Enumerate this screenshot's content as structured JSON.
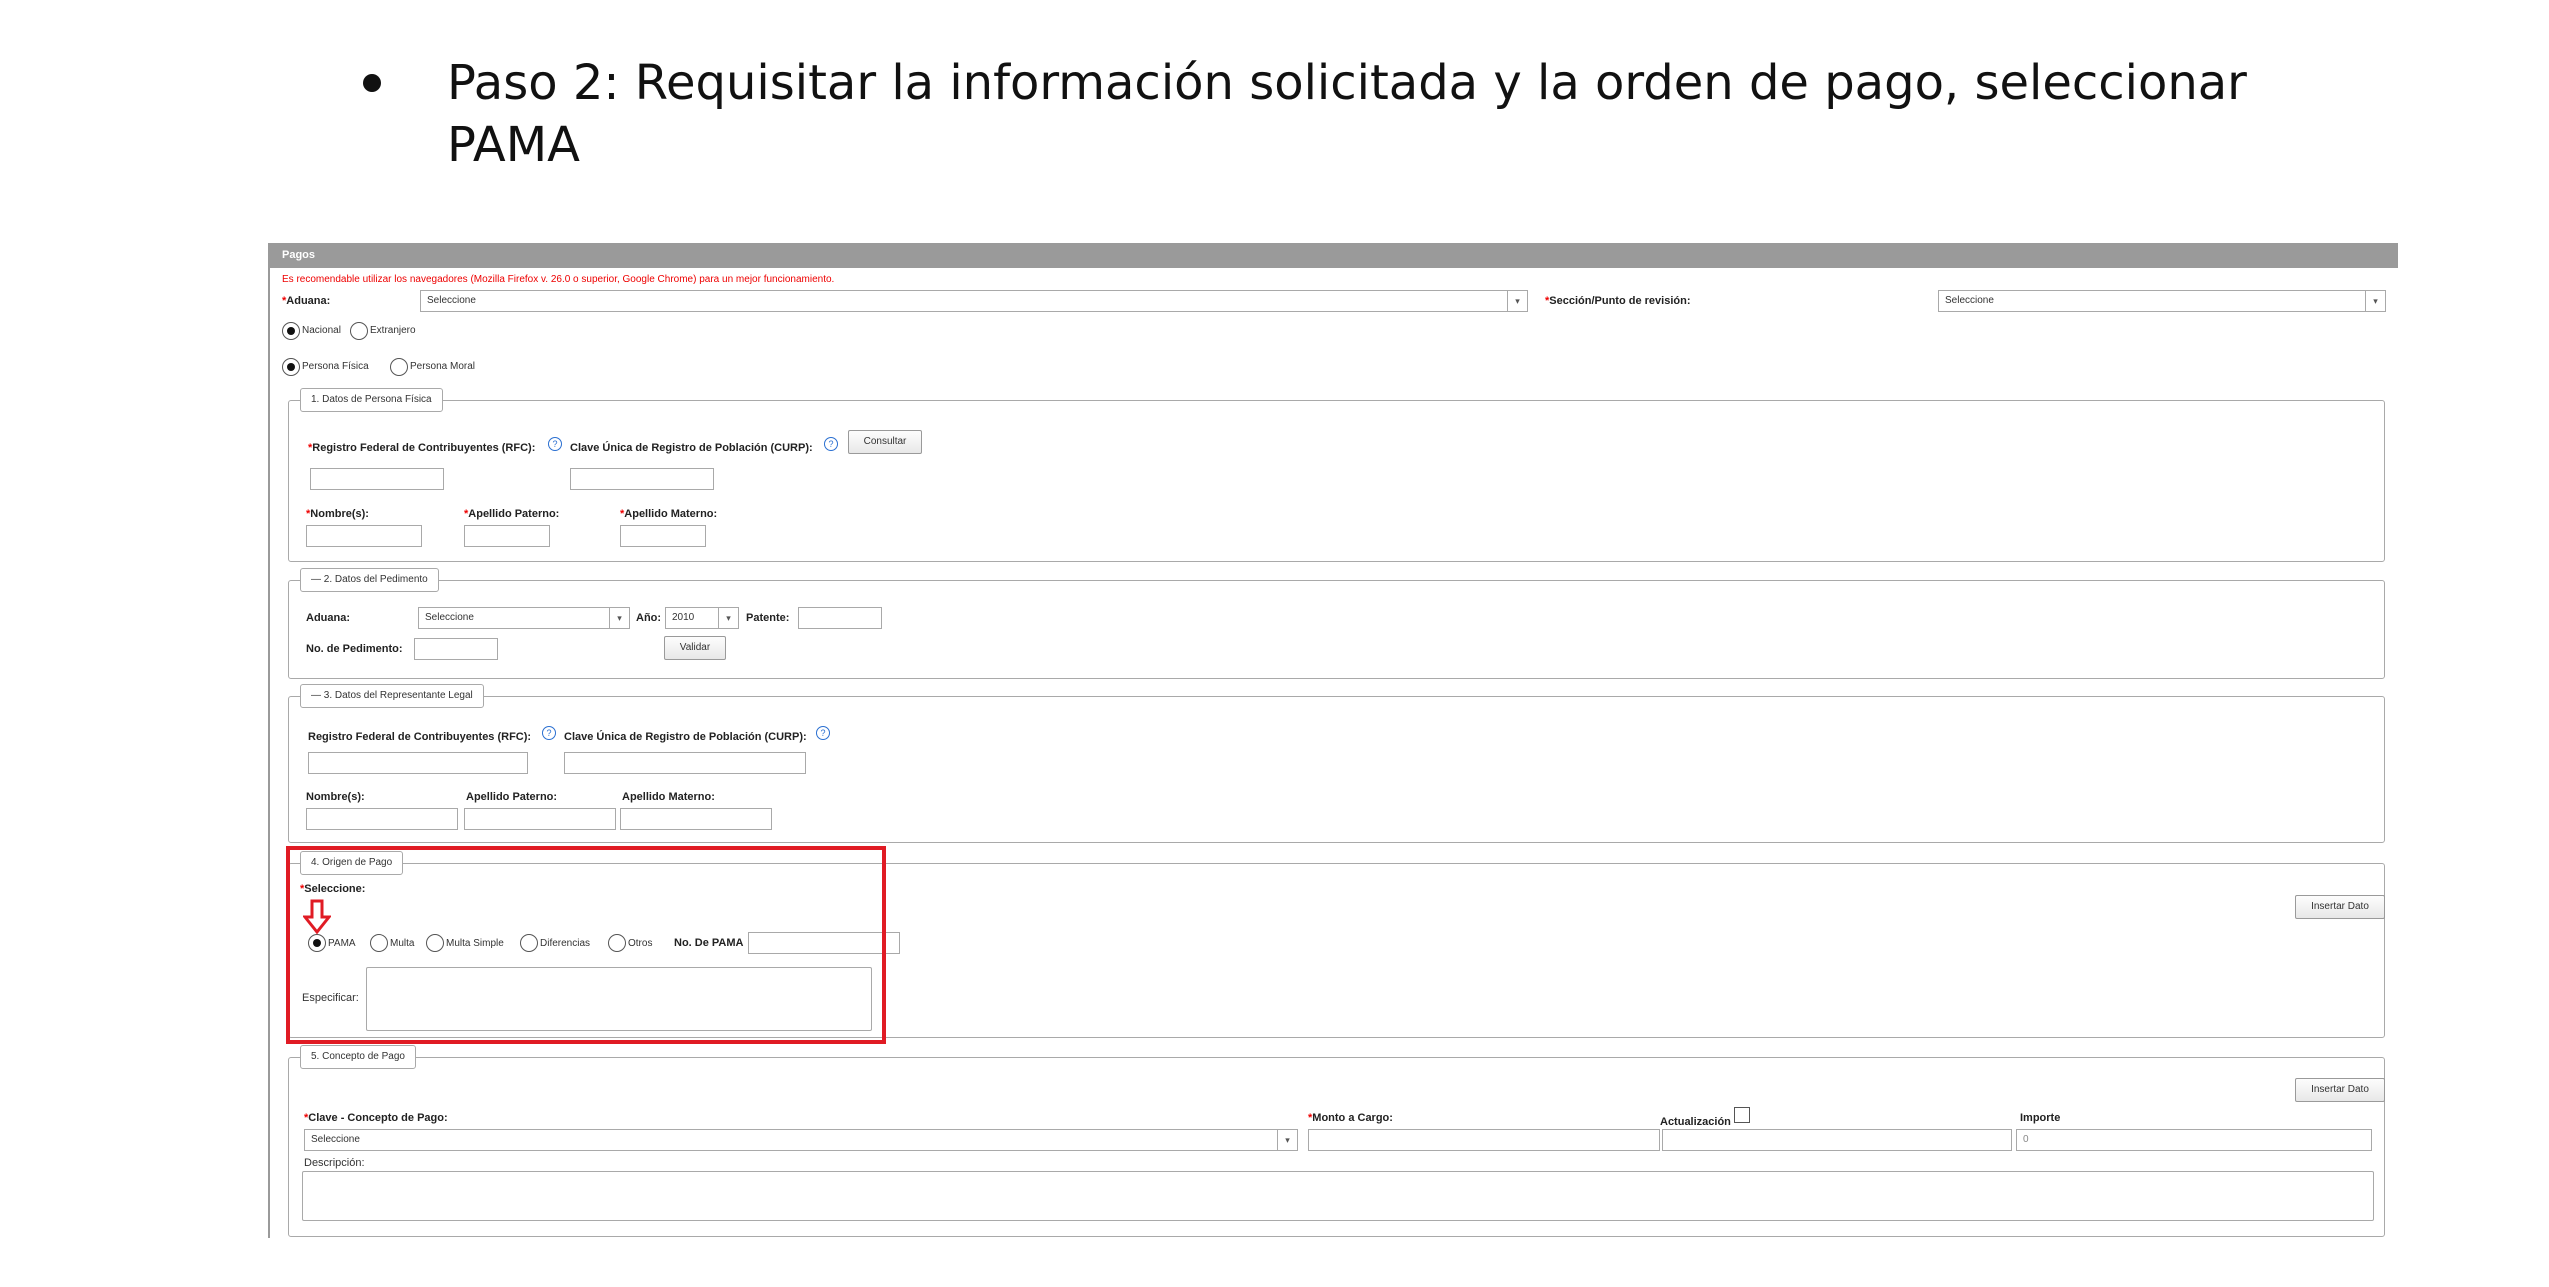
{
  "doc": {
    "step_text": "Paso 2: Requisitar la información solicitada y la orden de pago, seleccionar PAMA"
  },
  "form": {
    "panel_title": "Pagos",
    "notice": "Es recomendable utilizar los navegadores (Mozilla Firefox v. 26.0 o superior, Google Chrome) para un mejor funcionamiento.",
    "aduana_label": "Aduana:",
    "aduana_value": "Seleccione",
    "seccion_label": "Sección/Punto de revisión:",
    "seccion_value": "Seleccione",
    "origen_options": [
      {
        "label": "Nacional",
        "selected": true
      },
      {
        "label": "Extranjero",
        "selected": false
      }
    ],
    "persona_options": [
      {
        "label": "Persona Física",
        "selected": true
      },
      {
        "label": "Persona Moral",
        "selected": false
      }
    ],
    "section1": {
      "legend": "1. Datos de Persona Física",
      "rfc_label": "Registro Federal de Contribuyentes (RFC):",
      "curp_label": "Clave Única de Registro de Población (CURP):",
      "consultar_button": "Consultar",
      "nombre_label": "Nombre(s):",
      "apellido_paterno_label": "Apellido Paterno:",
      "apellido_materno_label": "Apellido Materno:"
    },
    "section2": {
      "legend": "— 2. Datos del Pedimento",
      "aduana_label": "Aduana:",
      "aduana_value": "Seleccione",
      "anio_label": "Año:",
      "anio_value": "2010",
      "patente_label": "Patente:",
      "pedimento_label": "No. de Pedimento:",
      "validar_button": "Validar"
    },
    "section3": {
      "legend": "— 3. Datos del Representante Legal",
      "rfc_label": "Registro Federal de Contribuyentes (RFC):",
      "curp_label": "Clave Única de Registro de Población (CURP):",
      "nombre_label": "Nombre(s):",
      "apellido_paterno_label": "Apellido Paterno:",
      "apellido_materno_label": "Apellido Materno:"
    },
    "section4": {
      "legend": "4. Origen de Pago",
      "seleccione_label": "Seleccione:",
      "options": [
        {
          "label": "PAMA",
          "selected": true
        },
        {
          "label": "Multa",
          "selected": false
        },
        {
          "label": "Multa Simple",
          "selected": false
        },
        {
          "label": "Diferencias",
          "selected": false
        },
        {
          "label": "Otros",
          "selected": false
        }
      ],
      "pama_number_label": "No. De PAMA",
      "especificar_label": "Especificar:",
      "insertar_button": "Insertar Dato"
    },
    "section5": {
      "legend": "5. Concepto de Pago",
      "insertar_button": "Insertar Dato",
      "clave_label": "Clave - Concepto de Pago:",
      "clave_value": "Seleccione",
      "monto_label": "Monto a Cargo:",
      "actualizacion_label": "Actualización",
      "importe_label": "Importe",
      "importe_value": "0",
      "descripcion_label": "Descripción:"
    }
  },
  "colors": {
    "header_bg": "#9a9a9a",
    "required_star": "#ee0000",
    "highlight": "#e01b24",
    "help_icon": "#2a6fd1"
  }
}
